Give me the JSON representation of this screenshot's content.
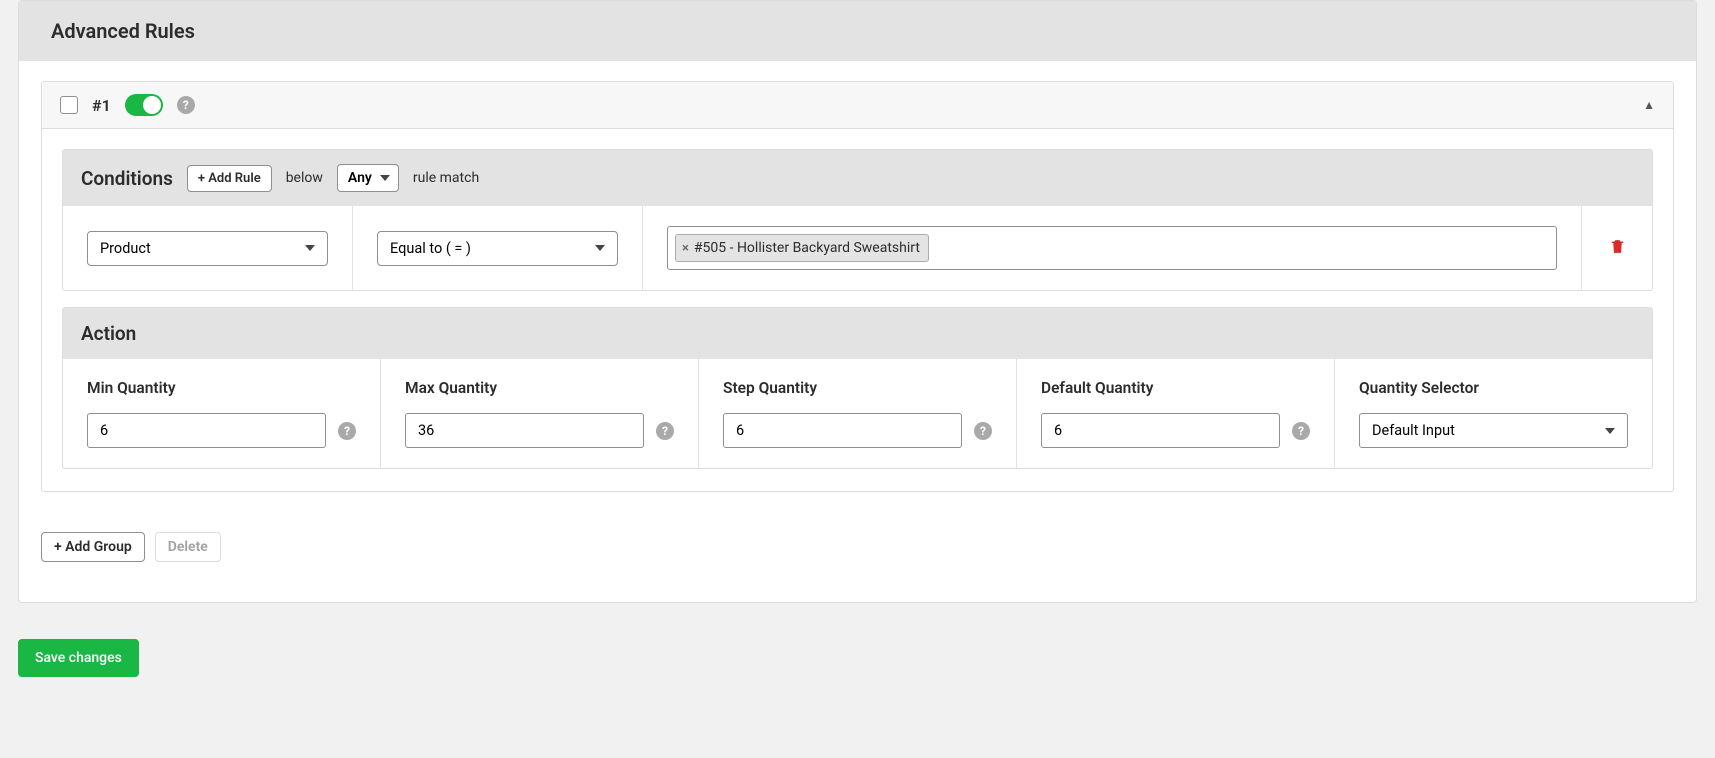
{
  "panel": {
    "title": "Advanced Rules"
  },
  "group": {
    "number_label": "#1",
    "enabled": true
  },
  "conditions": {
    "title": "Conditions",
    "add_rule_label": "+ Add Rule",
    "below_text": "below",
    "match_mode_value": "Any",
    "rule_match_text": "rule match",
    "row": {
      "field_value": "Product",
      "operator_value": "Equal to ( = )",
      "tag_value": "#505 - Hollister Backyard Sweatshirt"
    }
  },
  "action": {
    "title": "Action",
    "min_qty_label": "Min Quantity",
    "min_qty_value": "6",
    "max_qty_label": "Max Quantity",
    "max_qty_value": "36",
    "step_qty_label": "Step Quantity",
    "step_qty_value": "6",
    "default_qty_label": "Default Quantity",
    "default_qty_value": "6",
    "selector_label": "Quantity Selector",
    "selector_value": "Default Input"
  },
  "footer": {
    "add_group_label": "+ Add Group",
    "delete_label": "Delete"
  },
  "save": {
    "label": "Save changes"
  }
}
